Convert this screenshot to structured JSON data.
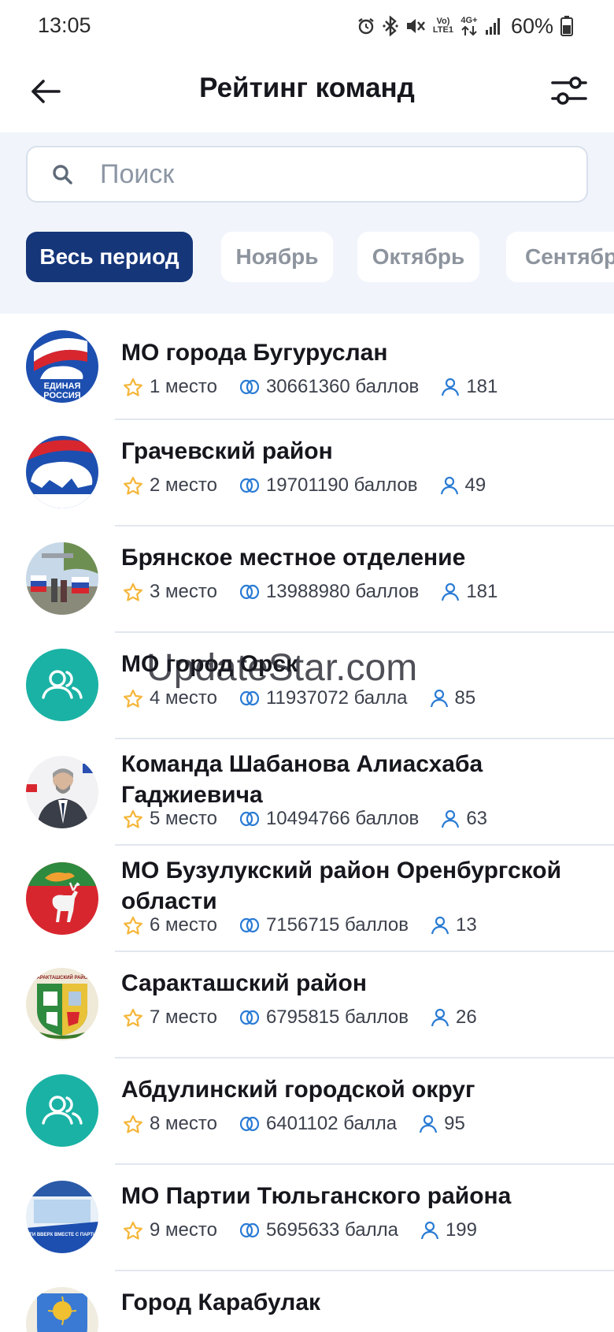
{
  "status_bar": {
    "time": "13:05",
    "network_top": "Vo)",
    "network_bottom": "LTE1",
    "network_gen": "4G+",
    "battery": "60%",
    "icons": [
      "alarm-icon",
      "bluetooth-icon",
      "mute-icon",
      "volte-icon",
      "data-arrows-icon",
      "signal-icon",
      "battery-icon"
    ]
  },
  "header": {
    "title": "Рейтинг команд",
    "back_icon": "arrow-left-icon",
    "filter_icon": "sliders-icon"
  },
  "search": {
    "placeholder": "Поиск",
    "value": ""
  },
  "period_tabs": [
    {
      "label": "Весь период",
      "active": true
    },
    {
      "label": "Ноябрь",
      "active": false
    },
    {
      "label": "Октябрь",
      "active": false
    },
    {
      "label": "Сентябрь",
      "active": false
    }
  ],
  "teams": [
    {
      "name": "МО города Бугуруслан",
      "place": "1 место",
      "points": "30661360 баллов",
      "members": "181",
      "avatar": "party-logo"
    },
    {
      "name": "Грачевский район",
      "place": "2 место",
      "points": "19701190 баллов",
      "members": "49",
      "avatar": "bear-logo"
    },
    {
      "name": "Брянское местное отделение",
      "place": "3 место",
      "points": "13988980 баллов",
      "members": "181",
      "avatar": "photo-flags"
    },
    {
      "name": "МО город Орск",
      "place": "4 место",
      "points": "11937072 балла",
      "members": "85",
      "avatar": "placeholder-team"
    },
    {
      "name": "Команда Шабанова Алиасхаба Гаджиевича",
      "place": "5 место",
      "points": "10494766 баллов",
      "members": "63",
      "avatar": "photo-person"
    },
    {
      "name": "МО Бузулукский район Оренбургской области",
      "place": "6 место",
      "points": "7156715 баллов",
      "members": "13",
      "avatar": "coat-of-arms-deer"
    },
    {
      "name": "Саракташский район",
      "place": "7 место",
      "points": "6795815 баллов",
      "members": "26",
      "avatar": "coat-of-arms-saraktash",
      "avatar_text": "САРАКТАШСКИЙ РАЙОН"
    },
    {
      "name": "Абдулинский городской округ",
      "place": "8 место",
      "points": "6401102 балла",
      "members": "95",
      "avatar": "placeholder-team"
    },
    {
      "name": "МО Партии Тюльганского района",
      "place": "9 место",
      "points": "5695633 балла",
      "members": "199",
      "avatar": "poster-blue",
      "avatar_text": "РАСТИ ВВЕРХ ВМЕСТЕ С ПАРТИЕЙ!"
    },
    {
      "name": "Город Карабулак",
      "place": "",
      "points": "",
      "members": "",
      "avatar": "coat-of-arms-karabulak"
    }
  ],
  "party_logo_text": {
    "line1": "ЕДИНАЯ",
    "line2": "РОССИЯ"
  },
  "watermark": "UpdateStar.com",
  "colors": {
    "accent_navy": "#16367a",
    "teal_placeholder": "#1ab2a5",
    "star_gold": "#f5b63a",
    "stat_icon_blue": "#2a7bd4",
    "panel_bg": "#f1f5fb"
  }
}
